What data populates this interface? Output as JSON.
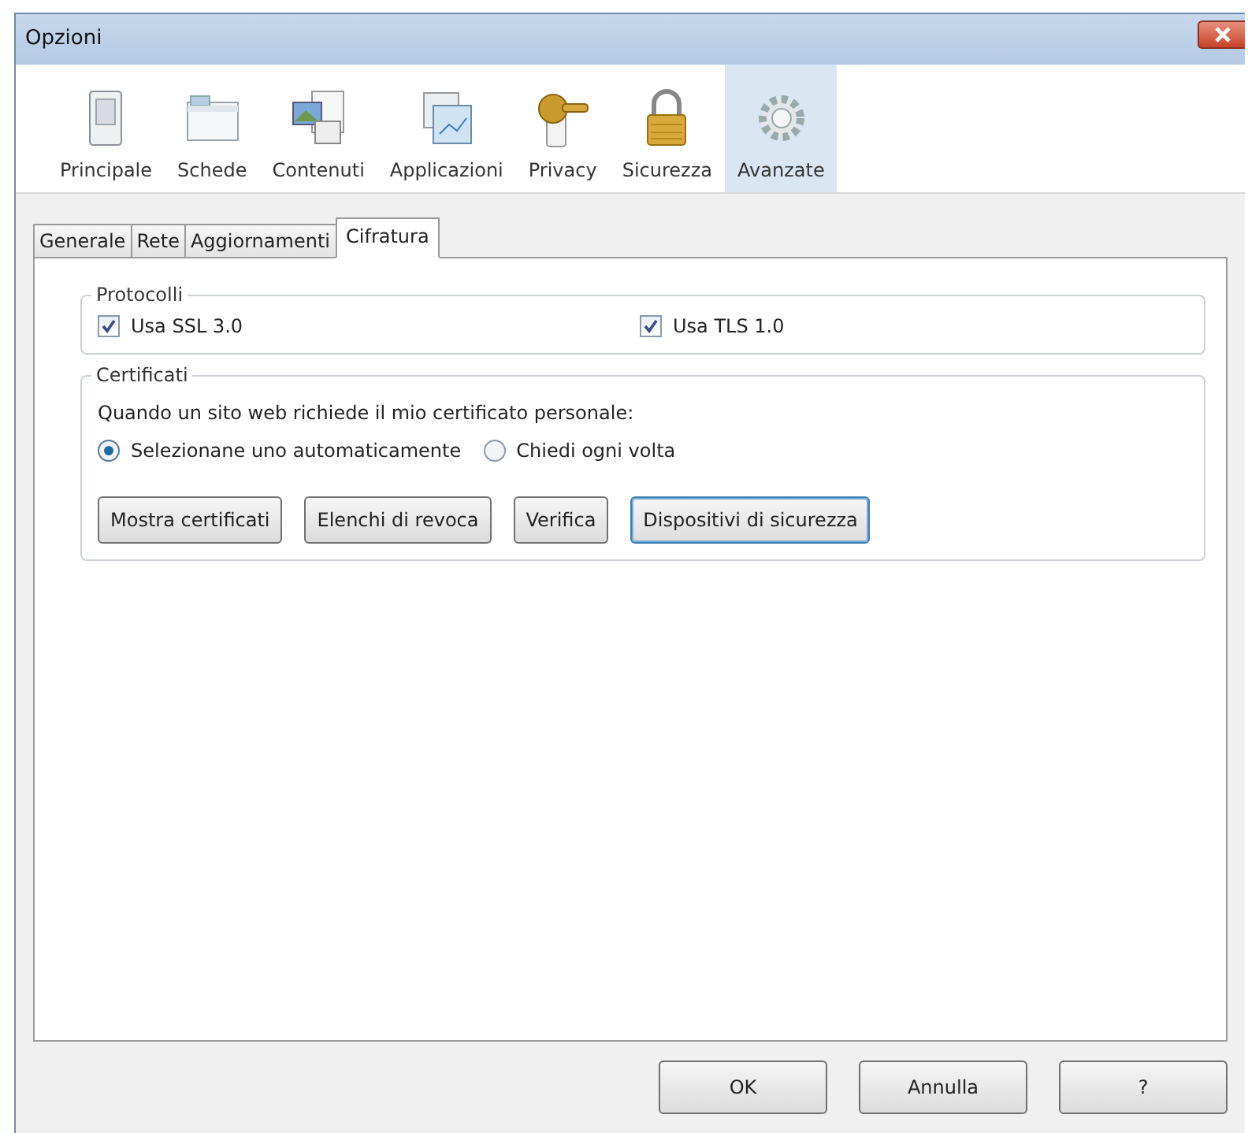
{
  "window": {
    "title": "Opzioni"
  },
  "panes": [
    {
      "label": "Principale",
      "selected": false
    },
    {
      "label": "Schede",
      "selected": false
    },
    {
      "label": "Contenuti",
      "selected": false
    },
    {
      "label": "Applicazioni",
      "selected": false
    },
    {
      "label": "Privacy",
      "selected": false
    },
    {
      "label": "Sicurezza",
      "selected": false
    },
    {
      "label": "Avanzate",
      "selected": true
    }
  ],
  "tabs": [
    {
      "label": "Generale",
      "selected": false
    },
    {
      "label": "Rete",
      "selected": false
    },
    {
      "label": "Aggiornamenti",
      "selected": false
    },
    {
      "label": "Cifratura",
      "selected": true
    }
  ],
  "protocols": {
    "title": "Protocolli",
    "options": [
      {
        "label": "Usa SSL 3.0",
        "checked": true
      },
      {
        "label": "Usa TLS 1.0",
        "checked": true
      }
    ]
  },
  "certificates": {
    "title": "Certificati",
    "prompt": "Quando un sito web richiede il mio certificato personale:",
    "choices": [
      {
        "label": "Selezionane uno automaticamente",
        "selected": true
      },
      {
        "label": "Chiedi ogni volta",
        "selected": false
      }
    ],
    "buttons": [
      {
        "label": "Mostra certificati",
        "focused": false
      },
      {
        "label": "Elenchi di revoca",
        "focused": false
      },
      {
        "label": "Verifica",
        "focused": false
      },
      {
        "label": "Dispositivi di sicurezza",
        "focused": true
      }
    ]
  },
  "footer_buttons": [
    "OK",
    "Annulla",
    "?"
  ]
}
